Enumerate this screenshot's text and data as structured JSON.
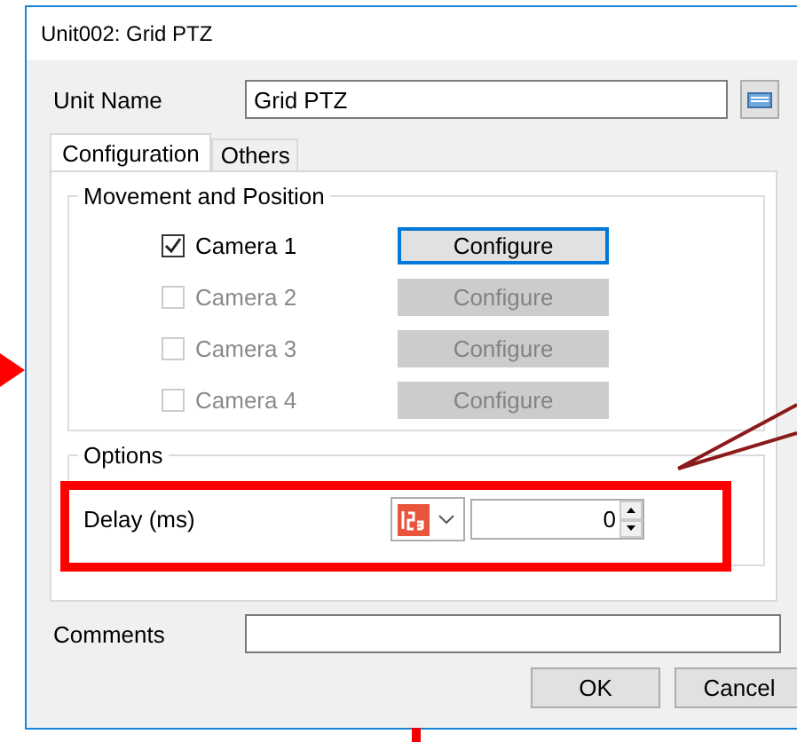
{
  "window": {
    "title": "Unit002: Grid PTZ"
  },
  "unit_name": {
    "label": "Unit Name",
    "value": "Grid PTZ"
  },
  "tabs": [
    {
      "label": "Configuration",
      "selected": true
    },
    {
      "label": "Others",
      "selected": false
    }
  ],
  "movement_group": {
    "title": "Movement and Position",
    "cameras": [
      {
        "label": "Camera 1",
        "checked": true,
        "disabled": false,
        "button": "Configure"
      },
      {
        "label": "Camera 2",
        "checked": false,
        "disabled": true,
        "button": "Configure"
      },
      {
        "label": "Camera 3",
        "checked": false,
        "disabled": true,
        "button": "Configure"
      },
      {
        "label": "Camera 4",
        "checked": false,
        "disabled": true,
        "button": "Configure"
      }
    ]
  },
  "options_group": {
    "title": "Options",
    "delay": {
      "label": "Delay (ms)",
      "value": "0"
    }
  },
  "comments": {
    "label": "Comments"
  },
  "buttons": [
    "OK",
    "Cancel"
  ]
}
